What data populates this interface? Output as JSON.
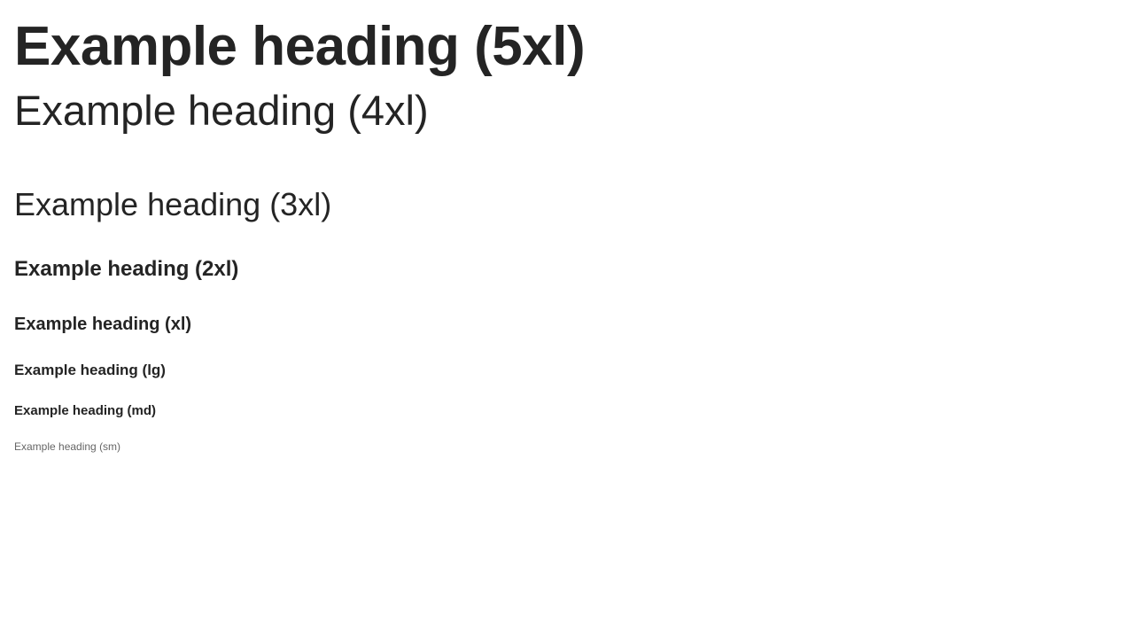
{
  "headings": {
    "h5xl": "Example heading (5xl)",
    "h4xl": "Example heading (4xl)",
    "h3xl": "Example heading (3xl)",
    "h2xl": "Example heading (2xl)",
    "hxl": "Example heading (xl)",
    "hlg": "Example heading (lg)",
    "hmd": "Example heading (md)",
    "hsm": "Example heading (sm)"
  },
  "colors": {
    "text": "#242424",
    "muted_text": "#666666",
    "background": "#ffffff"
  }
}
